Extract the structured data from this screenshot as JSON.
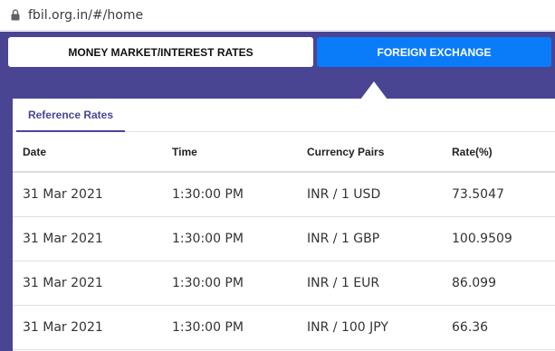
{
  "browser": {
    "url": "fbil.org.in/#/home"
  },
  "nav": {
    "tabs": [
      {
        "label": "MONEY MARKET/INTEREST RATES"
      },
      {
        "label": "FOREIGN EXCHANGE"
      }
    ],
    "active_tab": "FOREIGN EXCHANGE"
  },
  "reference": {
    "subtab_label": "Reference Rates",
    "columns": [
      "Date",
      "Time",
      "Currency Pairs",
      "Rate(%)"
    ],
    "rows": [
      {
        "date": "31 Mar 2021",
        "time": "1:30:00 PM",
        "pair": "INR / 1 USD",
        "rate": "73.5047"
      },
      {
        "date": "31 Mar 2021",
        "time": "1:30:00 PM",
        "pair": "INR / 1 GBP",
        "rate": "100.9509"
      },
      {
        "date": "31 Mar 2021",
        "time": "1:30:00 PM",
        "pair": "INR / 1 EUR",
        "rate": "86.099"
      },
      {
        "date": "31 Mar 2021",
        "time": "1:30:00 PM",
        "pair": "INR / 100 JPY",
        "rate": "66.36"
      }
    ]
  },
  "colors": {
    "page_bg": "#4a4593",
    "active_tab_bg": "#0a7cf9",
    "accent": "#4a4593"
  }
}
